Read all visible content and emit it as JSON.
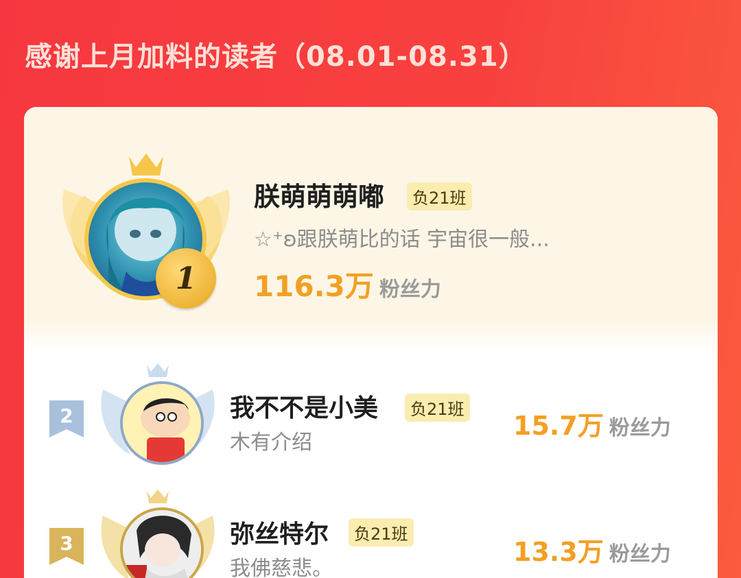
{
  "header": {
    "title": "感谢上月加料的读者（08.01-08.31）"
  },
  "colors": {
    "background": "#f63a3f",
    "accent_gold": "#f2a024",
    "tag_bg": "#fbecb0"
  },
  "rankings": [
    {
      "rank": "1",
      "name": "朕萌萌萌嘟",
      "tag": "负21班",
      "desc": "☆⁺ʚ跟朕萌比的话 宇宙很一般...",
      "score": "116.3万",
      "score_unit": "粉丝力"
    },
    {
      "rank": "2",
      "name": "我不不是小美",
      "tag": "负21班",
      "desc": "木有介绍",
      "score": "15.7万",
      "score_unit": "粉丝力"
    },
    {
      "rank": "3",
      "name": "弥丝特尔",
      "tag": "负21班",
      "desc": "我佛慈悲。",
      "score": "13.3万",
      "score_unit": "粉丝力"
    }
  ]
}
